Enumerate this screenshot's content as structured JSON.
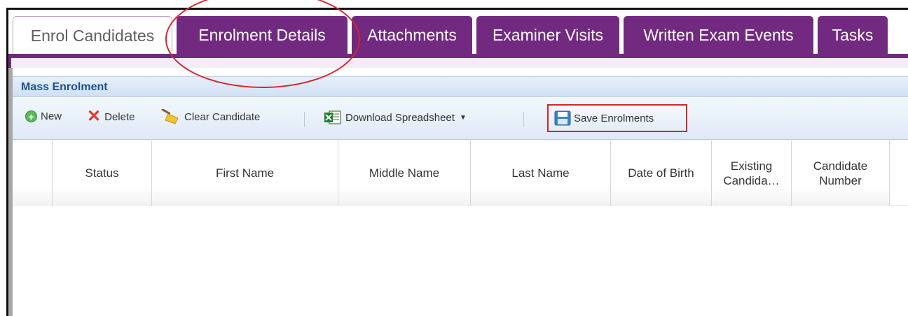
{
  "tabs": [
    {
      "label": "Enrol Candidates",
      "active": true
    },
    {
      "label": "Enrolment Details",
      "active": false
    },
    {
      "label": "Attachments",
      "active": false
    },
    {
      "label": "Examiner Visits",
      "active": false
    },
    {
      "label": "Written Exam Events",
      "active": false
    },
    {
      "label": "Tasks",
      "active": false
    }
  ],
  "panel": {
    "title": "Mass Enrolment"
  },
  "toolbar": {
    "new_label": "New",
    "delete_label": "Delete",
    "clear_label": "Clear Candidate",
    "download_label": "Download Spreadsheet",
    "save_label": "Save Enrolments"
  },
  "grid": {
    "columns": [
      "",
      "Status",
      "First Name",
      "Middle Name",
      "Last Name",
      "Date of Birth",
      "Existing Candida…",
      "Candidate Number"
    ]
  },
  "colors": {
    "tab_purple": "#712a7f",
    "header_blue": "#1b4f8f",
    "annotation_red": "#d8232a"
  },
  "icons": {
    "new": "plus-circle-icon",
    "delete": "x-icon",
    "clear": "broom-icon",
    "download": "spreadsheet-icon",
    "save": "floppy-disk-icon"
  }
}
